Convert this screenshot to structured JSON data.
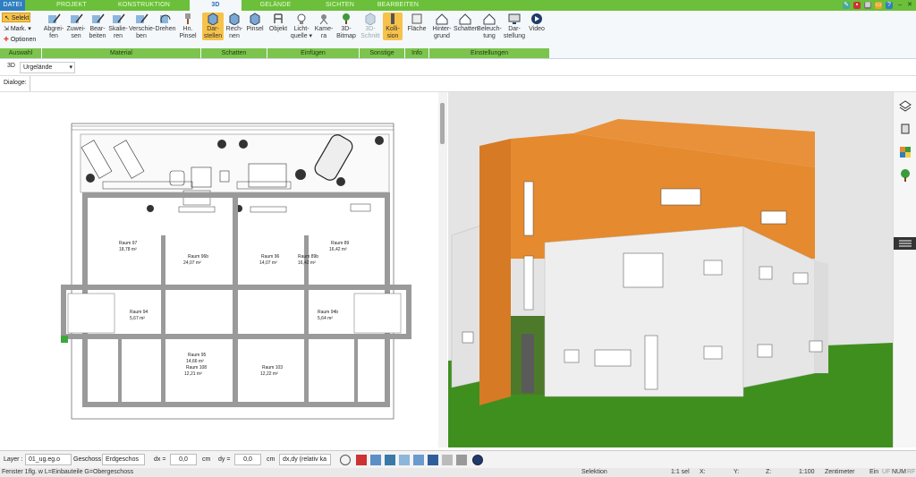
{
  "tabs": [
    "DATEI",
    "PROJEKT",
    "KONSTRUKTION",
    "3D",
    "GELÄNDE",
    "SICHTEN",
    "BEARBEITEN"
  ],
  "active_tab": "3D",
  "left_buttons": [
    "Selekt",
    "Mark.",
    "Optionen"
  ],
  "groups": [
    "Auswahl",
    "Material",
    "Schatten",
    "Einfügen",
    "Sonstige",
    "Info",
    "Einstellungen"
  ],
  "ribbon": {
    "abgreifen": "Abgrei-\nfen",
    "zuweisen": "Zuwei-\nsen",
    "bearbeiten": "Bear-\nbeiten",
    "skalieren": "Skalie-\nren",
    "verschieben": "Verschie-\nben",
    "drehen": "Drehen",
    "hinpinsel": "Hn.\nPinsel",
    "darstellen": "Dar-\nstellen",
    "rechnen": "Rech-\nnen",
    "pinsel": "Pinsel",
    "objekt": "Objekt",
    "lichtquelle": "Licht-\nquelle",
    "kamera": "Kame-\nra",
    "bitmap": "3D-\nBitmap",
    "schnitt": "3D-\nSchnitt",
    "kollision": "Kolli-\nsion",
    "flaeche": "Fläche",
    "hintergrund": "Hinter-\ngrund",
    "schatten": "Schatten",
    "beleuchtung": "Beleuch-\ntung",
    "darstellung": "Dar-\nstellung",
    "video": "Video"
  },
  "viewbar": {
    "mode": "3D",
    "terrain": "Urgelände"
  },
  "dialoge": "Dialoge:",
  "rooms": [
    {
      "name": "Raum 97",
      "area": "18,78 m²"
    },
    {
      "name": "Raum 96",
      "area": "14,07 m²"
    },
    {
      "name": "Raum 89",
      "area": "16,42 m²"
    },
    {
      "name": "Raum 94",
      "area": "5,67 m²"
    },
    {
      "name": "Raum 95",
      "area": "14,66 m²"
    },
    {
      "name": "Raum 108",
      "area": "12,21 m²"
    },
    {
      "name": "Raum 103",
      "area": "12,22 m²"
    },
    {
      "name": "Raum 96b",
      "area": "24,07 m²"
    },
    {
      "name": "Raum 94b",
      "area": "5,64 m²"
    },
    {
      "name": "Raum 89b",
      "area": "16,42 m²"
    }
  ],
  "toolbar": {
    "layer_label": "Layer :",
    "layer_value": "01_ug.eg.o",
    "geschoss_label": "Geschoss :",
    "geschoss_value": "Erdgeschos",
    "dx_label": "dx =",
    "dx_value": "0,0",
    "dx_unit": "cm",
    "dy_label": "dy =",
    "dy_value": "0,0",
    "dy_unit": "cm",
    "mode_value": "dx,dy (relativ ka"
  },
  "status": {
    "hint": "Fenster 1flg. w L=Einbauteile G=Obergeschoss",
    "mode": "Selektion",
    "sel": "1:1 sel",
    "x": "X:",
    "y": "Y:",
    "z": "Z:",
    "scale": "1:100",
    "unit": "Zentimeter",
    "ein": "Ein",
    "uf": "UF",
    "num": "NUM",
    "rf": "RF"
  },
  "colors": {
    "green": "#6bbf3a",
    "orange": "#e58a2e",
    "sky": "#e6e6e6",
    "grass": "#3f8f1f"
  }
}
